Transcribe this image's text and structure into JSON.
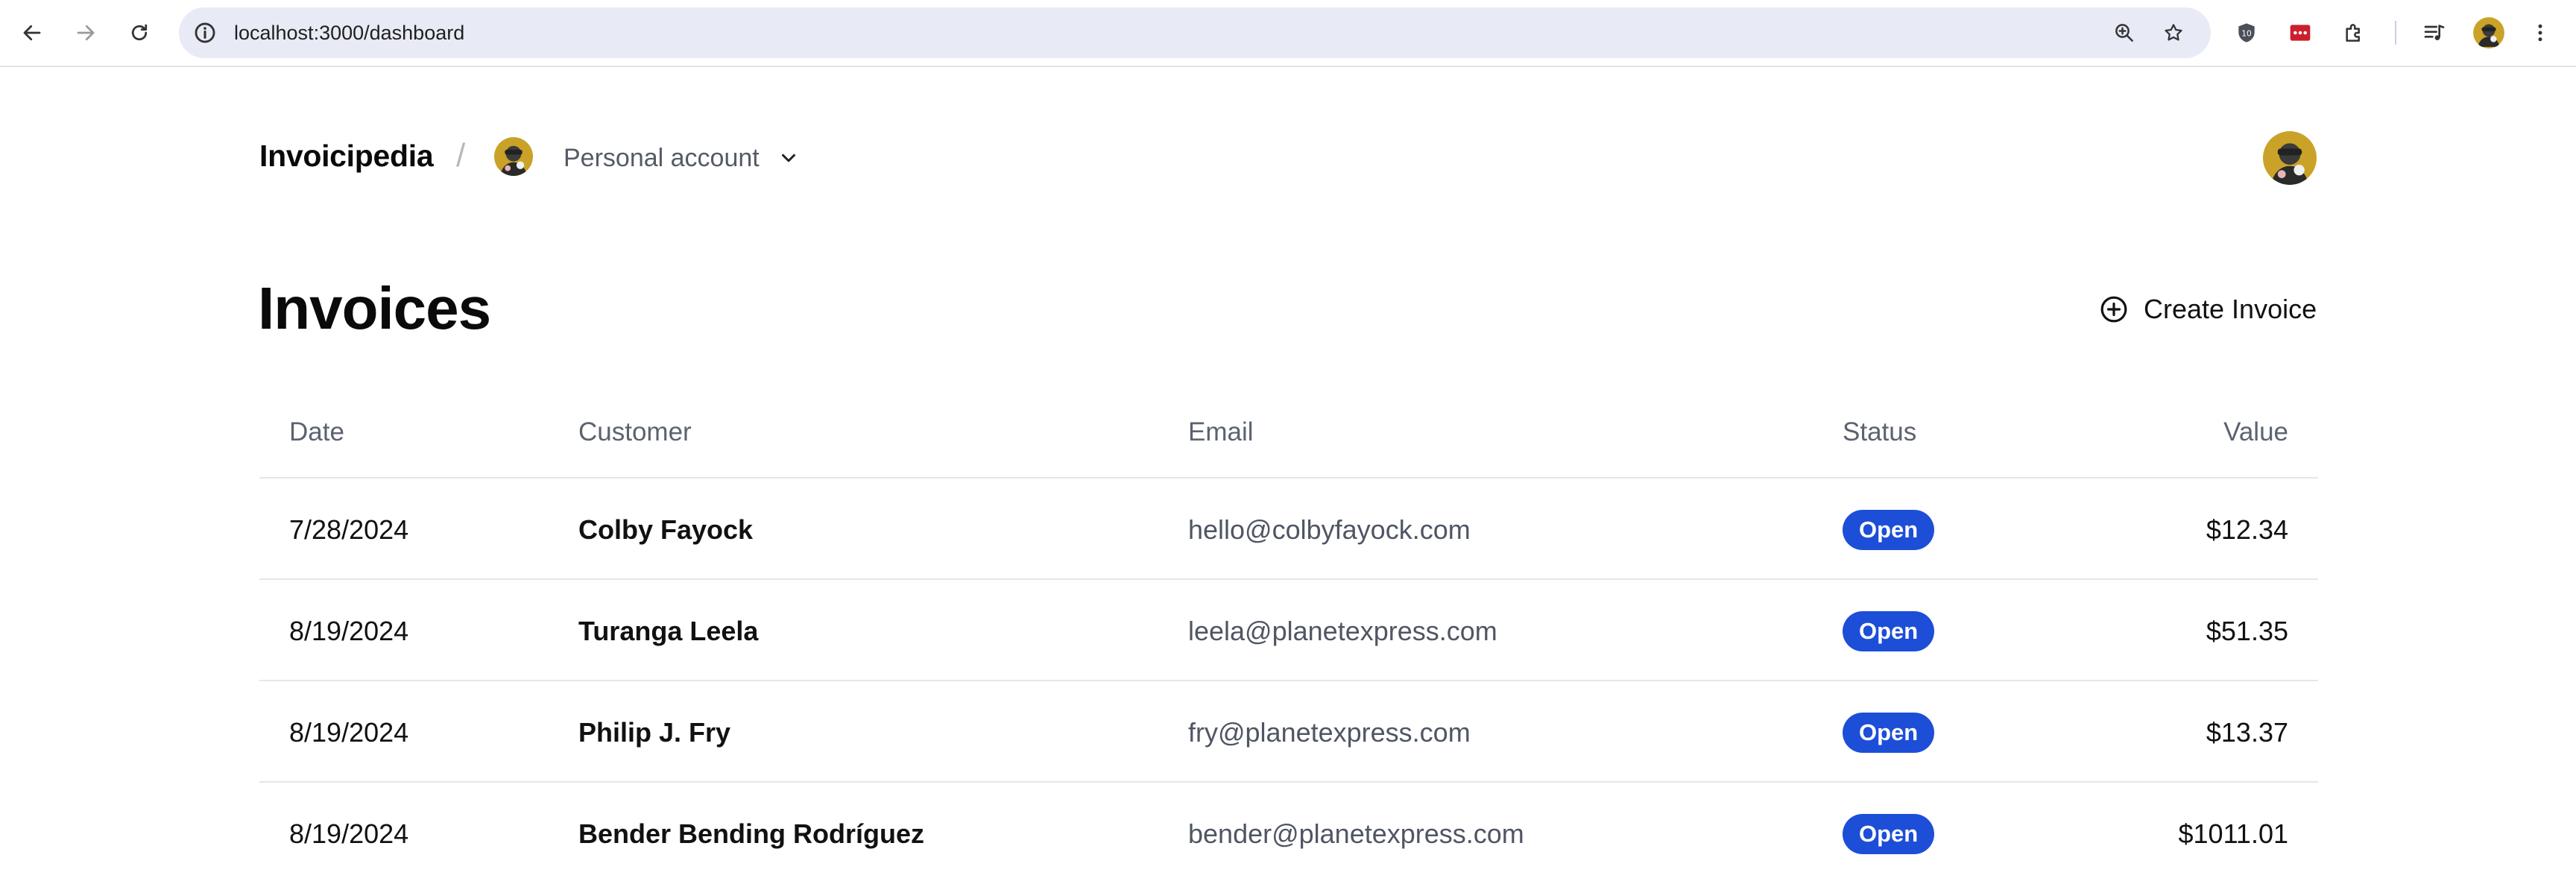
{
  "browser": {
    "url": "localhost:3000/dashboard"
  },
  "header": {
    "brand": "Invoicipedia",
    "separator": "/",
    "account_label": "Personal account"
  },
  "page": {
    "title": "Invoices",
    "create_label": "Create Invoice"
  },
  "table": {
    "columns": [
      "Date",
      "Customer",
      "Email",
      "Status",
      "Value"
    ],
    "rows": [
      {
        "date": "7/28/2024",
        "customer": "Colby Fayock",
        "email": "hello@colbyfayock.com",
        "status": "Open",
        "value": "$12.34"
      },
      {
        "date": "8/19/2024",
        "customer": "Turanga Leela",
        "email": "leela@planetexpress.com",
        "status": "Open",
        "value": "$51.35"
      },
      {
        "date": "8/19/2024",
        "customer": "Philip J. Fry",
        "email": "fry@planetexpress.com",
        "status": "Open",
        "value": "$13.37"
      },
      {
        "date": "8/19/2024",
        "customer": "Bender Bending Rodríguez",
        "email": "bender@planetexpress.com",
        "status": "Open",
        "value": "$1011.01"
      }
    ]
  },
  "colors": {
    "badge": "#1d4ed8",
    "url_bar": "#e8ebf5"
  }
}
